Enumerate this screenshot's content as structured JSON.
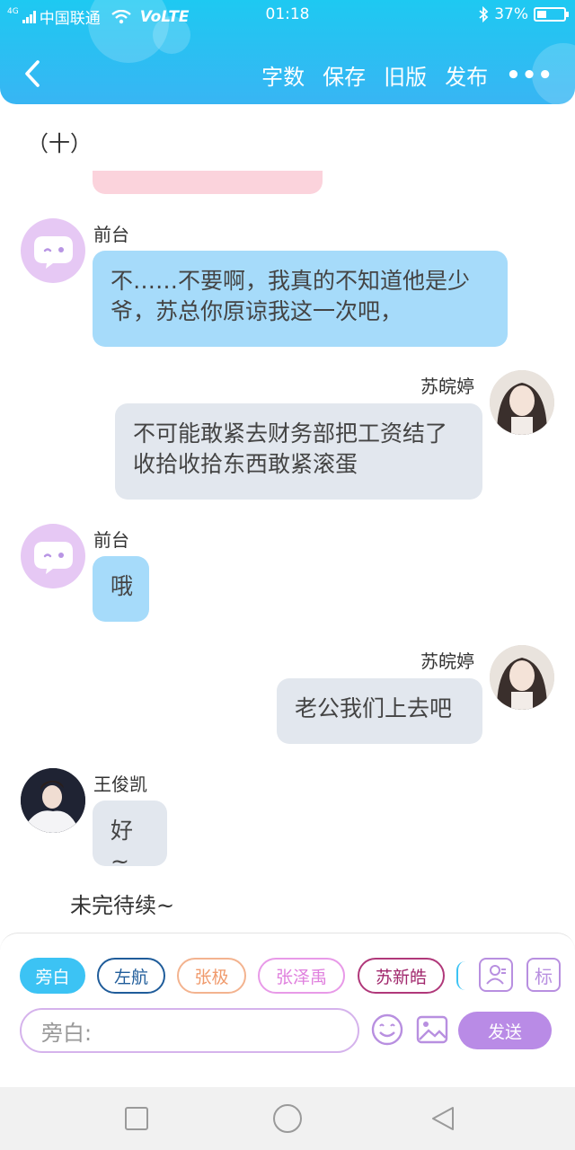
{
  "status_bar": {
    "carrier": "中国联通",
    "network_small": "4G",
    "volte": "VoLTE",
    "time": "01:18",
    "battery": "37%",
    "battery_level": 0.37
  },
  "header": {
    "actions": [
      "字数",
      "保存",
      "旧版",
      "发布"
    ],
    "more": "•••",
    "color": "#2ec0f3"
  },
  "story": {
    "section_title": "（十）",
    "narration": "未完待续~"
  },
  "messages": [
    {
      "speaker": "前台",
      "text": "不……不要啊，我真的不知道他是少爷，苏总你原谅我这一次吧，",
      "side": "left"
    },
    {
      "speaker": "苏皖婷",
      "text": "不可能敢紧去财务部把工资结了收拾收拾东西敢紧滚蛋",
      "side": "right"
    },
    {
      "speaker": "前台",
      "text": "哦",
      "side": "left"
    },
    {
      "speaker": "苏皖婷",
      "text": "老公我们上去吧",
      "side": "right"
    },
    {
      "speaker": "王俊凯",
      "text": "好~",
      "side": "left"
    }
  ],
  "composer": {
    "roles": [
      "旁白",
      "左航",
      "张极",
      "张泽禹",
      "苏新皓"
    ],
    "mark_icon_label": "标",
    "input_placeholder": "旁白:",
    "send_label": "发送"
  }
}
